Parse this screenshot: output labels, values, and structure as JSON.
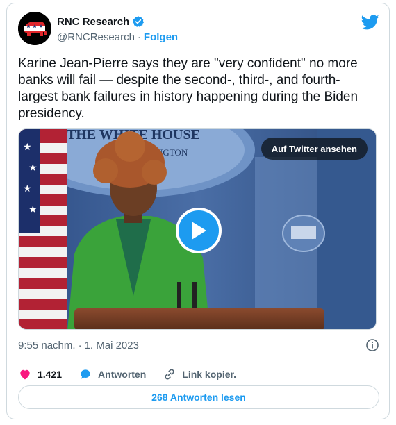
{
  "author": {
    "name": "RNC Research",
    "handle": "@RNCResearch",
    "separator": "·",
    "follow_label": "Folgen"
  },
  "tweet": {
    "text": "Karine Jean-Pierre says they are \"very confident\" no more banks will fail — despite the second-, third-, and fourth-largest bank failures in history happening during the Biden presidency."
  },
  "media": {
    "watch_label": "Auf Twitter ansehen",
    "backdrop_text": "THE WHITE HOUSE",
    "backdrop_subtext": "WASHINGTON"
  },
  "meta": {
    "time": "9:55 nachm.",
    "separator": "·",
    "date": "1. Mai 2023"
  },
  "actions": {
    "like_count": "1.421",
    "reply_label": "Antworten",
    "copy_label": "Link kopier."
  },
  "read_replies_label": "268 Antworten lesen",
  "colors": {
    "accent": "#1d9bf0",
    "like": "#f91880",
    "text": "#0f1419",
    "muted": "#536471"
  }
}
